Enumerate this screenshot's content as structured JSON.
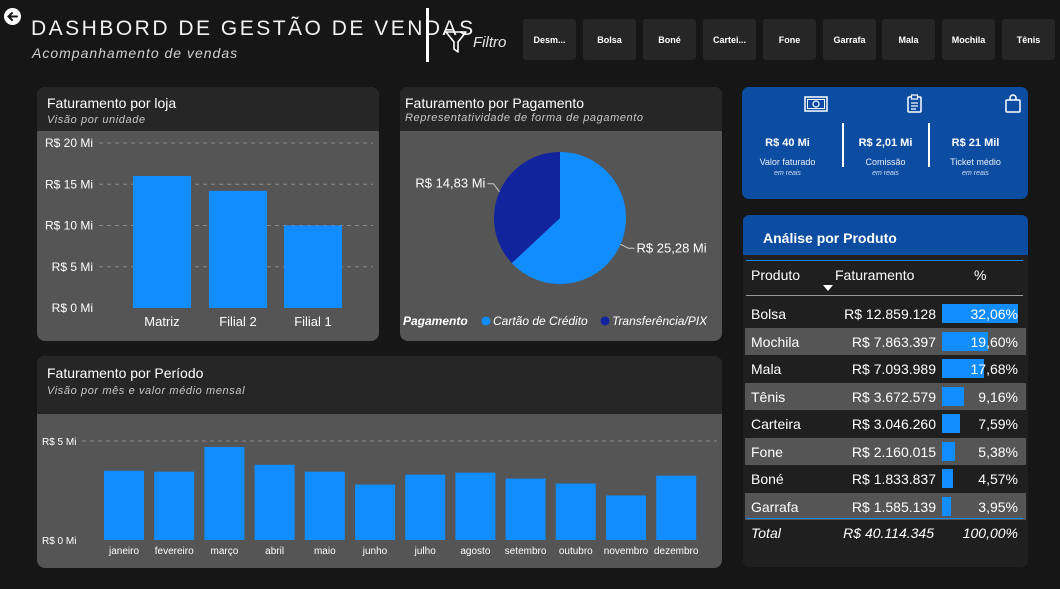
{
  "header": {
    "title": "DASHBORD DE GESTÃO DE VENDAS",
    "subtitle": "Acompanhamento de vendas",
    "filter_label": "Filtro",
    "product_buttons": [
      "Desm...",
      "Bolsa",
      "Boné",
      "Cartei...",
      "Fone",
      "Garrafa",
      "Mala",
      "Mochila",
      "Tênis"
    ]
  },
  "store_chart": {
    "title": "Faturamento por loja",
    "subtitle": "Visão por unidade"
  },
  "payment_chart": {
    "title": "Faturamento por Pagamento",
    "subtitle": "Representatividade de forma de pagamento",
    "legend_title": "Pagamento"
  },
  "period_chart": {
    "title": "Faturamento por Período",
    "subtitle": "Visão por mês e valor médio mensal"
  },
  "kpis": [
    {
      "value": "R$ 40 Mi",
      "label": "Valor faturado",
      "unit": "em reais",
      "icon": "money-icon"
    },
    {
      "value": "R$ 2,01 Mi",
      "label": "Comissão",
      "unit": "em reais",
      "icon": "clipboard-icon"
    },
    {
      "value": "R$ 21 Mil",
      "label": "Ticket médio",
      "unit": "em reais",
      "icon": "shopping-bag-icon"
    }
  ],
  "product_table": {
    "title": "Análise por Produto",
    "columns": [
      "Produto",
      "Faturamento",
      "%"
    ],
    "rows": [
      {
        "produto": "Bolsa",
        "faturamento": "R$ 12.859.128",
        "pct": "32,06%",
        "share": 32.06
      },
      {
        "produto": "Mochila",
        "faturamento": "R$ 7.863.397",
        "pct": "19,60%",
        "share": 19.6
      },
      {
        "produto": "Mala",
        "faturamento": "R$ 7.093.989",
        "pct": "17,68%",
        "share": 17.68
      },
      {
        "produto": "Tênis",
        "faturamento": "R$ 3.672.579",
        "pct": "9,16%",
        "share": 9.16
      },
      {
        "produto": "Carteira",
        "faturamento": "R$ 3.046.260",
        "pct": "7,59%",
        "share": 7.59
      },
      {
        "produto": "Fone",
        "faturamento": "R$ 2.160.015",
        "pct": "5,38%",
        "share": 5.38
      },
      {
        "produto": "Boné",
        "faturamento": "R$ 1.833.837",
        "pct": "4,57%",
        "share": 4.57
      },
      {
        "produto": "Garrafa",
        "faturamento": "R$ 1.585.139",
        "pct": "3,95%",
        "share": 3.95
      }
    ],
    "total": {
      "label": "Total",
      "faturamento": "R$ 40.114.345",
      "pct": "100,00%"
    }
  },
  "colors": {
    "accent": "#118dff",
    "dark_blue": "#12239e",
    "kpi_blue": "#0d4da1",
    "card_gray": "#555555",
    "card_header": "#262626",
    "background": "#161616"
  },
  "chart_data": [
    {
      "type": "bar",
      "title": "Faturamento por loja",
      "categories": [
        "Matriz",
        "Filial 2",
        "Filial 1"
      ],
      "values": [
        16.0,
        14.2,
        10.0
      ],
      "ylim": [
        0,
        20
      ],
      "yticks": [
        0,
        5,
        10,
        15,
        20
      ],
      "ytick_labels": [
        "R$ 0 Mi",
        "R$ 5 Mi",
        "R$ 10 Mi",
        "R$ 15 Mi",
        "R$ 20 Mi"
      ],
      "grid": true
    },
    {
      "type": "pie",
      "title": "Faturamento por Pagamento",
      "categories": [
        "Cartão de Crédito",
        "Transferência/PIX"
      ],
      "values": [
        25.28,
        14.83
      ],
      "data_labels": [
        "R$ 25,28 Mi",
        "R$ 14,83 Mi"
      ],
      "colors": [
        "#118dff",
        "#12239e"
      ],
      "legend": "bottom"
    },
    {
      "type": "bar",
      "title": "Faturamento por Período",
      "categories": [
        "janeiro",
        "fevereiro",
        "março",
        "abril",
        "maio",
        "junho",
        "julho",
        "agosto",
        "setembro",
        "outubro",
        "novembro",
        "dezembro"
      ],
      "values": [
        3.5,
        3.45,
        4.7,
        3.8,
        3.45,
        2.8,
        3.3,
        3.4,
        3.1,
        2.85,
        2.25,
        3.25
      ],
      "ylim": [
        0,
        5
      ],
      "yticks": [
        0,
        5
      ],
      "ytick_labels": [
        "R$ 0 Mi",
        "R$ 5 Mi"
      ],
      "grid": true
    }
  ]
}
